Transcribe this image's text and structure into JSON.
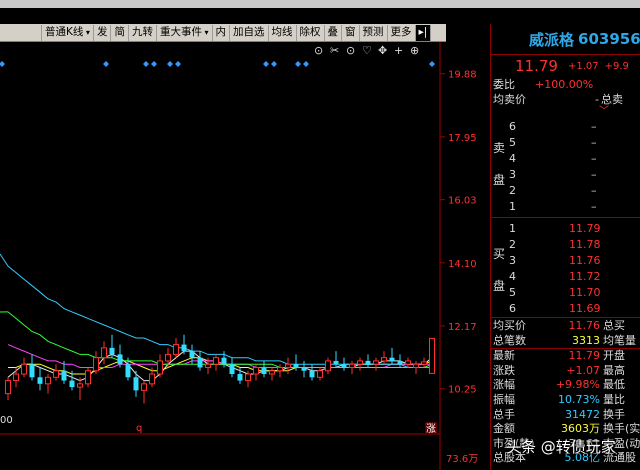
{
  "toolbar": {
    "items": [
      {
        "label": "普通K线",
        "dropdown": true
      },
      {
        "label": "发"
      },
      {
        "label": "简"
      },
      {
        "label": "九转"
      },
      {
        "label": "重大事件",
        "dropdown": true
      },
      {
        "label": "内"
      },
      {
        "label": "加自选"
      },
      {
        "label": "均线"
      },
      {
        "label": "除权"
      },
      {
        "label": "叠"
      },
      {
        "label": "窗"
      },
      {
        "label": "预测"
      },
      {
        "label": "更多"
      }
    ],
    "tools": [
      "⊙",
      "✂",
      "⊙",
      "♡",
      "✥",
      "+",
      "⊕"
    ]
  },
  "chart": {
    "price_labels": [
      "19.88",
      "17.95",
      "16.03",
      "14.10",
      "12.17",
      "10.25",
      "73.6万"
    ],
    "left_edge_label": "00",
    "marker_q": "q",
    "marker_zhang": "涨"
  },
  "chart_data": {
    "type": "candlestick",
    "ylim": [
      9.5,
      20.5
    ],
    "y_ticks": [
      19.88,
      17.95,
      16.03,
      14.1,
      12.17,
      10.25
    ],
    "candles": [
      [
        10.1,
        10.6,
        9.9,
        10.5
      ],
      [
        10.5,
        10.9,
        10.3,
        10.7
      ],
      [
        10.7,
        11.2,
        10.6,
        11.0
      ],
      [
        11.0,
        11.3,
        10.5,
        10.6
      ],
      [
        10.6,
        10.9,
        10.2,
        10.4
      ],
      [
        10.4,
        10.7,
        10.1,
        10.6
      ],
      [
        10.6,
        11.0,
        10.5,
        10.8
      ],
      [
        10.8,
        11.1,
        10.4,
        10.5
      ],
      [
        10.5,
        10.8,
        10.2,
        10.3
      ],
      [
        10.3,
        10.6,
        9.9,
        10.4
      ],
      [
        10.4,
        10.9,
        10.3,
        10.8
      ],
      [
        10.8,
        11.4,
        10.7,
        11.2
      ],
      [
        11.2,
        11.7,
        11.0,
        11.5
      ],
      [
        11.5,
        11.9,
        11.2,
        11.3
      ],
      [
        11.3,
        11.6,
        10.9,
        11.0
      ],
      [
        11.0,
        11.2,
        10.5,
        10.6
      ],
      [
        10.6,
        10.8,
        10.0,
        10.2
      ],
      [
        10.2,
        10.5,
        9.8,
        10.4
      ],
      [
        10.4,
        10.9,
        10.3,
        10.7
      ],
      [
        10.7,
        11.3,
        10.6,
        11.1
      ],
      [
        11.1,
        11.5,
        10.9,
        11.3
      ],
      [
        11.3,
        11.8,
        11.2,
        11.6
      ],
      [
        11.6,
        11.9,
        11.3,
        11.4
      ],
      [
        11.4,
        11.6,
        11.0,
        11.2
      ],
      [
        11.2,
        11.4,
        10.8,
        10.9
      ],
      [
        10.9,
        11.2,
        10.7,
        11.0
      ],
      [
        11.0,
        11.3,
        10.8,
        11.2
      ],
      [
        11.2,
        11.4,
        10.9,
        11.0
      ],
      [
        11.0,
        11.2,
        10.6,
        10.7
      ],
      [
        10.7,
        10.9,
        10.4,
        10.5
      ],
      [
        10.5,
        10.8,
        10.3,
        10.7
      ],
      [
        10.7,
        11.0,
        10.5,
        10.9
      ],
      [
        10.9,
        11.1,
        10.6,
        10.7
      ],
      [
        10.7,
        10.9,
        10.5,
        10.8
      ],
      [
        10.8,
        11.0,
        10.6,
        10.9
      ],
      [
        10.9,
        11.2,
        10.7,
        11.0
      ],
      [
        11.0,
        11.3,
        10.8,
        10.9
      ],
      [
        10.9,
        11.1,
        10.6,
        10.8
      ],
      [
        10.8,
        11.0,
        10.5,
        10.6
      ],
      [
        10.6,
        10.9,
        10.5,
        10.8
      ],
      [
        10.8,
        11.2,
        10.7,
        11.1
      ],
      [
        11.1,
        11.4,
        10.9,
        11.0
      ],
      [
        11.0,
        11.2,
        10.8,
        10.9
      ],
      [
        10.9,
        11.1,
        10.7,
        11.0
      ],
      [
        11.0,
        11.2,
        10.8,
        11.1
      ],
      [
        11.1,
        11.3,
        10.9,
        11.0
      ],
      [
        11.0,
        11.2,
        10.8,
        11.1
      ],
      [
        11.1,
        11.4,
        11.0,
        11.2
      ],
      [
        11.2,
        11.5,
        11.0,
        11.1
      ],
      [
        11.1,
        11.3,
        10.9,
        11.0
      ],
      [
        11.0,
        11.2,
        10.9,
        11.1
      ],
      [
        10.9,
        11.1,
        10.7,
        11.0
      ],
      [
        11.0,
        11.2,
        10.9,
        11.07
      ],
      [
        10.72,
        11.79,
        10.72,
        11.79
      ]
    ],
    "ma_series": [
      {
        "color": "#e8e8e8",
        "values": [
          10.6,
          10.8,
          11.0,
          11.0,
          10.9,
          10.8,
          10.7,
          10.7,
          10.6,
          10.5,
          10.6,
          10.9,
          11.2,
          11.3,
          11.2,
          11.0,
          10.7,
          10.5,
          10.5,
          10.7,
          11.0,
          11.2,
          11.4,
          11.4,
          11.2,
          11.0,
          11.0,
          11.0,
          10.9,
          10.8,
          10.7,
          10.7,
          10.8,
          10.8,
          10.8,
          10.9,
          10.9,
          10.9,
          10.8,
          10.8,
          10.9,
          10.9,
          11.0,
          11.0,
          11.0,
          11.0,
          11.0,
          11.1,
          11.1,
          11.1,
          11.0,
          11.0,
          11.0,
          11.2
        ]
      },
      {
        "color": "#ffff33",
        "values": [
          10.9,
          10.9,
          11.0,
          11.0,
          11.0,
          10.9,
          10.8,
          10.8,
          10.7,
          10.7,
          10.7,
          10.8,
          10.9,
          11.0,
          11.1,
          11.1,
          11.0,
          10.9,
          10.8,
          10.8,
          10.9,
          11.0,
          11.1,
          11.2,
          11.2,
          11.1,
          11.1,
          11.0,
          11.0,
          10.9,
          10.9,
          10.8,
          10.8,
          10.8,
          10.8,
          10.8,
          10.9,
          10.9,
          10.9,
          10.9,
          10.9,
          10.9,
          10.9,
          10.9,
          11.0,
          11.0,
          11.0,
          11.0,
          11.0,
          11.0,
          11.0,
          11.0,
          11.0,
          11.1
        ]
      },
      {
        "color": "#ff44ff",
        "values": [
          11.6,
          11.5,
          11.4,
          11.3,
          11.2,
          11.1,
          11.1,
          11.0,
          11.0,
          10.9,
          10.9,
          10.9,
          10.9,
          10.9,
          11.0,
          11.0,
          11.0,
          11.0,
          11.0,
          11.0,
          11.0,
          11.0,
          11.0,
          11.1,
          11.1,
          11.1,
          11.1,
          11.0,
          11.0,
          11.0,
          11.0,
          10.9,
          10.9,
          10.9,
          10.9,
          10.9,
          10.9,
          10.9,
          10.9,
          10.9,
          10.9,
          10.9,
          10.9,
          10.9,
          10.9,
          10.9,
          10.9,
          10.9,
          11.0,
          11.0,
          11.0,
          11.0,
          11.0,
          11.0
        ]
      },
      {
        "color": "#33ff33",
        "values": [
          12.6,
          12.4,
          12.2,
          12.0,
          11.9,
          11.7,
          11.6,
          11.5,
          11.4,
          11.3,
          11.3,
          11.2,
          11.2,
          11.2,
          11.1,
          11.1,
          11.1,
          11.1,
          11.1,
          11.0,
          11.0,
          11.0,
          11.0,
          11.0,
          11.0,
          11.0,
          11.0,
          11.0,
          11.0,
          11.0,
          11.0,
          11.0,
          11.0,
          11.0,
          10.9,
          10.9,
          10.9,
          10.9,
          10.9,
          10.9,
          10.9,
          10.9,
          10.9,
          10.9,
          10.9,
          10.9,
          10.9,
          10.9,
          10.9,
          10.9,
          10.9,
          10.9,
          10.9,
          11.0
        ]
      },
      {
        "color": "#33ccff",
        "values": [
          14.0,
          13.8,
          13.6,
          13.4,
          13.2,
          13.0,
          12.9,
          12.7,
          12.6,
          12.5,
          12.4,
          12.3,
          12.2,
          12.1,
          12.0,
          11.9,
          11.8,
          11.8,
          11.7,
          11.6,
          11.6,
          11.5,
          11.5,
          11.4,
          11.4,
          11.3,
          11.3,
          11.3,
          11.2,
          11.2,
          11.2,
          11.1,
          11.1,
          11.1,
          11.1,
          11.0,
          11.0,
          11.0,
          11.0,
          11.0,
          11.0,
          11.0,
          11.0,
          11.0,
          11.0,
          11.0,
          11.0,
          11.0,
          11.0,
          11.0,
          10.9,
          10.9,
          10.9,
          10.9
        ]
      }
    ],
    "event_markers": [
      0,
      13,
      18,
      19,
      21,
      22,
      33,
      34,
      37,
      38
    ]
  },
  "panel": {
    "name": "威派格",
    "code": "603956",
    "price": "11.79",
    "change": "+1.07",
    "change_pct": "+9.9",
    "weibi_label": "委比",
    "weibi_value": "+100.00%",
    "avg_sell_label": "均卖价",
    "avg_sell_value": "-",
    "total_sell_label": "总卖",
    "sell_side": "卖盘",
    "buy_side": "买盘",
    "sell_levels": [
      {
        "level": "6",
        "price": "–"
      },
      {
        "level": "5",
        "price": "–"
      },
      {
        "level": "4",
        "price": "–"
      },
      {
        "level": "3",
        "price": "–"
      },
      {
        "level": "2",
        "price": "–"
      },
      {
        "level": "1",
        "price": "–"
      }
    ],
    "buy_levels": [
      {
        "level": "1",
        "price": "11.79"
      },
      {
        "level": "2",
        "price": "11.78"
      },
      {
        "level": "3",
        "price": "11.76"
      },
      {
        "level": "4",
        "price": "11.72"
      },
      {
        "level": "5",
        "price": "11.70"
      },
      {
        "level": "6",
        "price": "11.69"
      }
    ],
    "stats": [
      {
        "label": "均买价",
        "value": "11.76",
        "label2": "总买",
        "color": "red"
      },
      {
        "label": "总笔数",
        "value": "3313",
        "label2": "均笔量",
        "color": "yellow"
      },
      {
        "label": "最新",
        "value": "11.79",
        "label2": "开盘",
        "color": "red"
      },
      {
        "label": "涨跌",
        "value": "+1.07",
        "label2": "最高",
        "color": "red"
      },
      {
        "label": "涨幅",
        "value": "+9.98%",
        "label2": "最低",
        "color": "red"
      },
      {
        "label": "振幅",
        "value": "10.73%",
        "label2": "量比",
        "color": "cyan"
      },
      {
        "label": "总手",
        "value": "31472",
        "label2": "换手",
        "color": "cyan"
      },
      {
        "label": "金额",
        "value": "3603万",
        "label2": "换手(实",
        "color": "yellow"
      },
      {
        "label": "市盈(静)",
        "value": "30.61",
        "label2": "市盈(动",
        "color": "white"
      },
      {
        "label": "总股本",
        "value": "5.08亿",
        "label2": "流通股",
        "color": "cyan"
      }
    ]
  },
  "watermark": "头条 @转债玩家"
}
